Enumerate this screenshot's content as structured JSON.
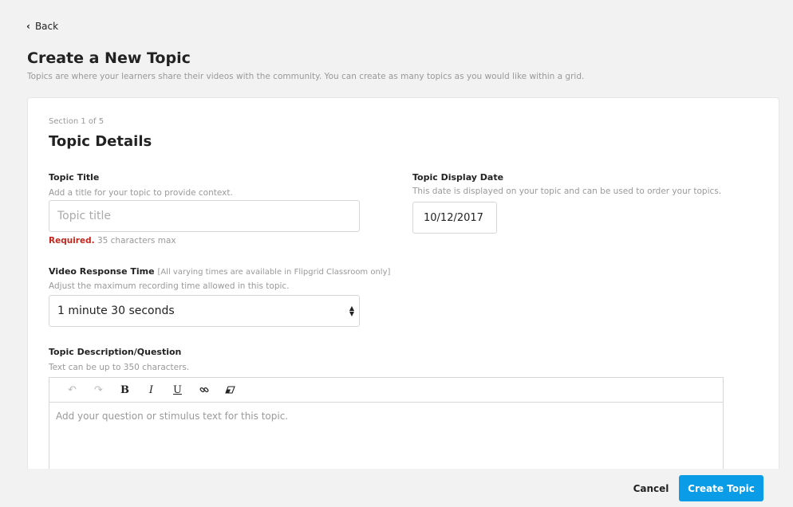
{
  "nav": {
    "back_label": "Back"
  },
  "header": {
    "title": "Create a New Topic",
    "subtitle": "Topics are where your learners share their videos with the community. You can create as many topics as you would like within a grid."
  },
  "section": {
    "step": "Section 1 of 5",
    "title": "Topic Details"
  },
  "topic_title": {
    "label": "Topic Title",
    "help": "Add a title for your topic to provide context.",
    "placeholder": "Topic title",
    "value": "",
    "required_label": "Required.",
    "max_note": "35 characters max"
  },
  "display_date": {
    "label": "Topic Display Date",
    "help": "This date is displayed on your topic and can be used to order your topics.",
    "value": "10/12/2017"
  },
  "response_time": {
    "label": "Video Response Time",
    "note": "[All varying times are available in Flipgrid Classroom only]",
    "help": "Adjust the maximum recording time allowed in this topic.",
    "selected": "1 minute 30 seconds"
  },
  "description": {
    "label": "Topic Description/Question",
    "help": "Text can be up to 350 characters.",
    "placeholder": "Add your question or stimulus text for this topic.",
    "toolbar": {
      "undo_icon": "undo-icon",
      "redo_icon": "redo-icon",
      "bold": "B",
      "italic": "I",
      "underline": "U",
      "link_icon": "link-icon",
      "clear_icon": "eraser-icon"
    }
  },
  "footer": {
    "cancel_label": "Cancel",
    "create_label": "Create Topic"
  },
  "colors": {
    "primary": "#0b9ce8",
    "required": "#c0281e",
    "background": "#f2f2f2"
  }
}
